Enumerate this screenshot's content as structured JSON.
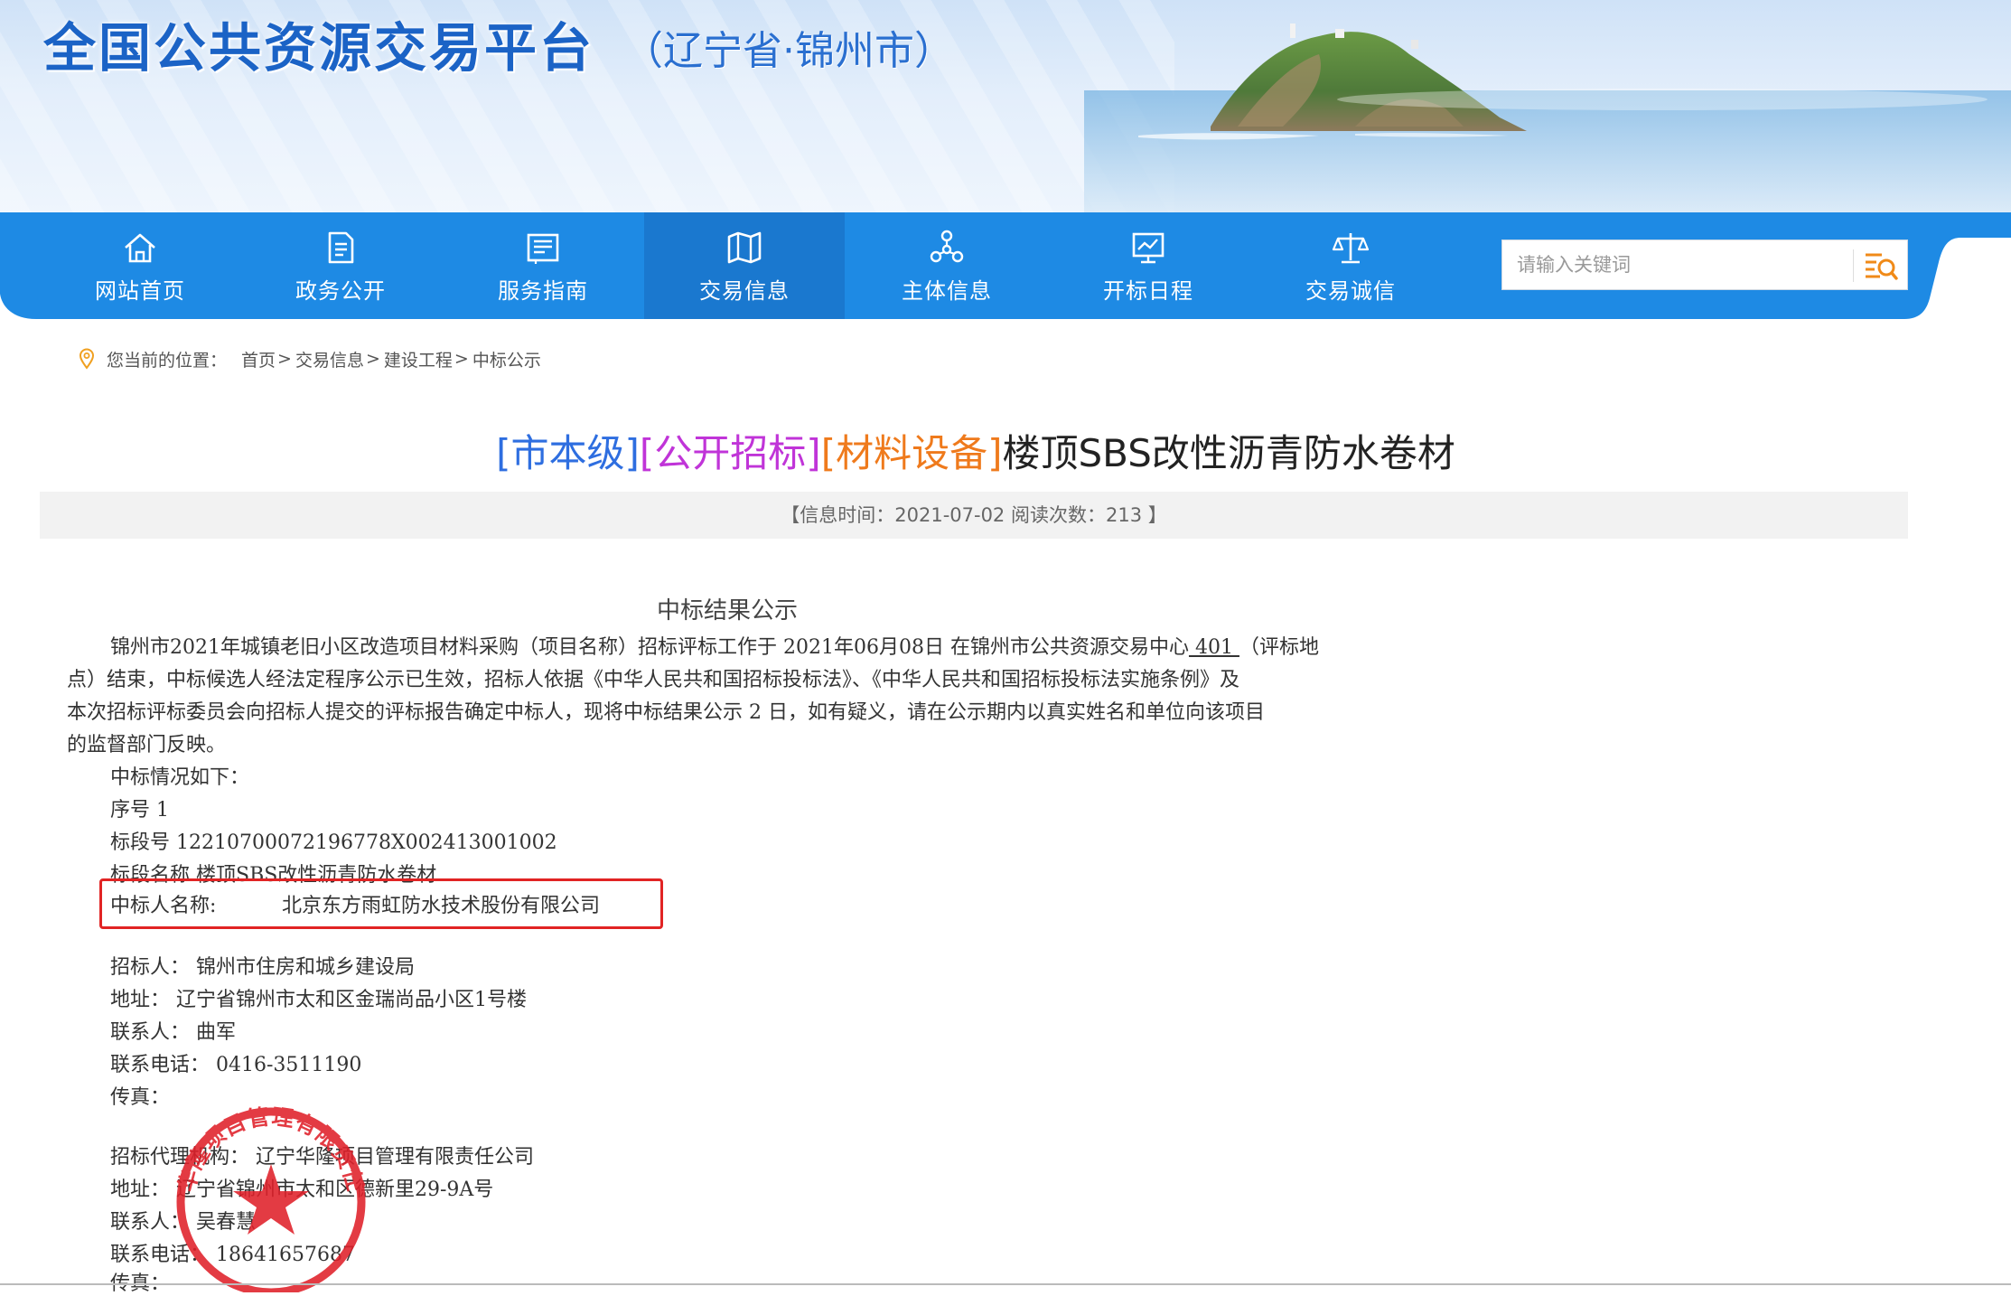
{
  "header": {
    "site_title": "全国公共资源交易平台",
    "site_subtitle": "（辽宁省·锦州市）"
  },
  "nav": {
    "items": [
      {
        "label": "网站首页",
        "icon": "home-icon"
      },
      {
        "label": "政务公开",
        "icon": "document-icon"
      },
      {
        "label": "服务指南",
        "icon": "guide-icon"
      },
      {
        "label": "交易信息",
        "icon": "map-icon",
        "active": true
      },
      {
        "label": "主体信息",
        "icon": "network-icon"
      },
      {
        "label": "开标日程",
        "icon": "chart-board-icon"
      },
      {
        "label": "交易诚信",
        "icon": "scale-icon"
      }
    ],
    "colors": {
      "bar": "#1e8ae4",
      "active": "#1a78cf"
    }
  },
  "search": {
    "placeholder": "请输入关键词",
    "button_icon": "search-list-icon"
  },
  "breadcrumb": {
    "label": "您当前的位置：",
    "items": [
      "首页",
      "交易信息",
      "建设工程",
      "中标公示"
    ],
    "separator": ">"
  },
  "article": {
    "title_tags": [
      "[市本级]",
      "[公开招标]",
      "[材料设备]"
    ],
    "title_main": "楼顶SBS改性沥青防水卷材",
    "meta": "【信息时间：2021-07-02   阅读次数：213 】"
  },
  "doc": {
    "heading": "中标结果公示",
    "para_line1_a": "锦州市2021年城镇老旧小区改造项目材料采购（项目名称）招标评标工作于 2021年06月08日 在锦州市公共资源交易中心",
    "para_line1_room": " 401 ",
    "para_line1_b": "（评标地",
    "para_line2": "点）结束，中标候选人经法定程序公示已生效，招标人依据《中华人民共和国招标投标法》、《中华人民共和国招标投标法实施条例》及",
    "para_line3": "本次招标评标委员会向招标人提交的评标报告确定中标人，现将中标结果公示 2 日，如有疑义，请在公示期内以真实姓名和单位向该项目",
    "para_line4": "的监督部门反映。",
    "intro": "中标情况如下：",
    "seq": "序号 1",
    "section_no": "标段号 12210700072196778X002413001002",
    "section_name": "标段名称 楼顶SBS改性沥青防水卷材",
    "winner_label": "中标人名称:",
    "winner_name": "北京东方雨虹防水技术股份有限公司",
    "tenderer": "招标人：  锦州市住房和城乡建设局",
    "tenderer_addr": "地址：  辽宁省锦州市太和区金瑞尚品小区1号楼",
    "tenderer_contact": "联系人：  曲军",
    "tenderer_phone": "联系电话：  0416-3511190",
    "tenderer_fax": "传真：",
    "agent": "招标代理机构：  辽宁华隆项目管理有限责任公司",
    "agent_addr": "地址：  辽宁省锦州市太和区德新里29-9A号",
    "agent_contact": "联系人：  吴春慧",
    "agent_phone": "联系电话：  18641657687",
    "agent_fax": "传真："
  },
  "seal": {
    "text": "辽宁华隆项目管理有限责任公司",
    "color": "#e0202a"
  }
}
